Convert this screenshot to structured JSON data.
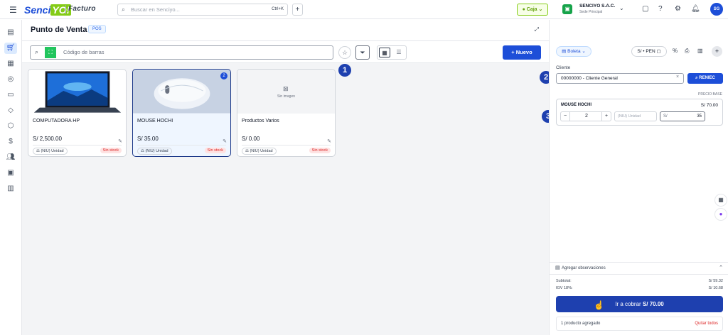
{
  "topbar": {
    "logo_main": "Senci",
    "logo_yo": "YO!",
    "logo_sub": "Facturo",
    "search_placeholder": "Buscar en Senciyo...",
    "search_shortcut": "Ctrl+K",
    "caja_label": "Caja",
    "company_name": "SENCIYO S.A.C.",
    "company_branch": "Sede Principal",
    "avatar_initials": "SG"
  },
  "page": {
    "title": "Punto de Venta",
    "badge": "POS"
  },
  "toolbar": {
    "barcode_placeholder": "Código de barras",
    "new_label": "Nuevo"
  },
  "callouts": [
    "1",
    "2",
    "3"
  ],
  "products": [
    {
      "name": "COMPUTADORA HP",
      "price": "S/ 2,500.00",
      "unit": "(NIU) Unidad",
      "stock": "Sin stock"
    },
    {
      "name": "MOUSE HOCHI",
      "price": "S/ 35.00",
      "unit": "(NIU) Unidad",
      "stock": "Sin stock",
      "qty": "2"
    },
    {
      "name": "Productos Varios",
      "price": "S/ 0.00",
      "unit": "(NIU) Unidad",
      "stock": "Sin stock",
      "no_image": "Sin imagen"
    }
  ],
  "panel": {
    "doc_type": "Boleta",
    "currency": "S/ • PEN",
    "percent_icon": "%",
    "cliente_label": "Cliente",
    "cliente_value": "00000000 - Cliente General",
    "reniec_label": "RENIEC",
    "precio_base_label": "PRECIO BASE",
    "line_item": {
      "name": "MOUSE HOCHI",
      "total": "S/ 70.00",
      "qty": "2",
      "unit_placeholder": "(NIU) Unidad",
      "currency": "S/",
      "price": "35"
    },
    "observations_label": "Agregar observaciones",
    "subtotal_label": "Subtotal:",
    "subtotal_value": "S/ 59.32",
    "igv_label": "IGV 18%:",
    "igv_value": "S/ 10.68",
    "charge_prefix": "Ir a cobrar",
    "charge_amount": "S/ 70.00",
    "items_count": "1 producto agregado",
    "remove_all": "Quitar todos"
  },
  "colors": {
    "primary": "#1d4ed8",
    "accent_green": "#84cc16",
    "danger": "#dc2626"
  }
}
